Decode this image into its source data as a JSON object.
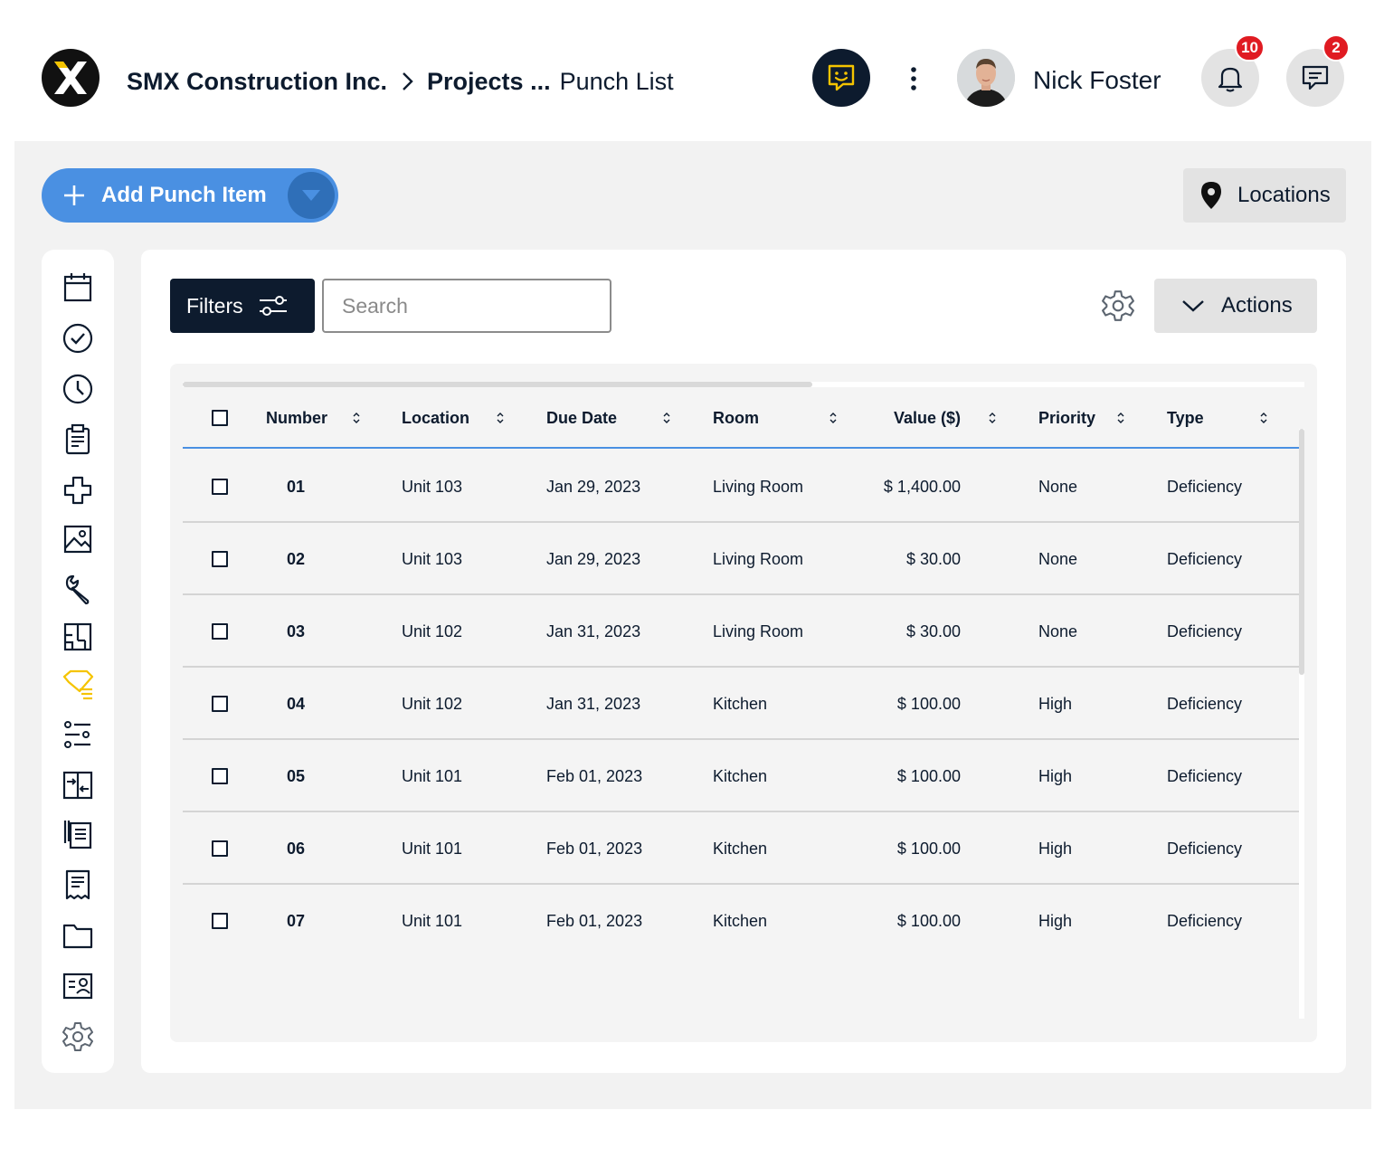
{
  "header": {
    "company": "SMX Construction Inc.",
    "breadcrumb_sep_icon": "chevron-right-icon",
    "projects": "Projects ...",
    "current_page": "Punch List",
    "user_name": "Nick Foster",
    "notifications_count": "10",
    "messages_count": "2",
    "accent_yellow": "#f5c400",
    "brand_navy": "#0d1b2e"
  },
  "toolbar": {
    "add_label": "Add Punch Item",
    "locations_label": "Locations",
    "primary_color": "#4a90e2"
  },
  "card": {
    "filters_label": "Filters",
    "search_placeholder": "Search",
    "actions_label": "Actions"
  },
  "sidebar": {
    "items": [
      {
        "icon": "calendar-icon"
      },
      {
        "icon": "check-circle-icon"
      },
      {
        "icon": "clock-icon"
      },
      {
        "icon": "clipboard-icon"
      },
      {
        "icon": "plus-cross-icon"
      },
      {
        "icon": "image-icon"
      },
      {
        "icon": "wrench-icon"
      },
      {
        "icon": "floorplan-icon"
      },
      {
        "icon": "punch-list-tag-icon",
        "active": true
      },
      {
        "icon": "sliders-list-icon"
      },
      {
        "icon": "transfer-icon"
      },
      {
        "icon": "document-stack-icon"
      },
      {
        "icon": "receipt-icon"
      },
      {
        "icon": "folder-icon"
      },
      {
        "icon": "contact-card-icon"
      },
      {
        "icon": "gear-icon"
      }
    ]
  },
  "table": {
    "columns": {
      "number": "Number",
      "location": "Location",
      "due_date": "Due Date",
      "room": "Room",
      "value": "Value ($)",
      "priority": "Priority",
      "type": "Type"
    },
    "rows": [
      {
        "number": "01",
        "location": "Unit 103",
        "due_date": "Jan 29, 2023",
        "room": "Living Room",
        "value": "$ 1,400.00",
        "priority": "None",
        "type": "Deficiency"
      },
      {
        "number": "02",
        "location": "Unit 103",
        "due_date": "Jan 29, 2023",
        "room": "Living Room",
        "value": "$ 30.00",
        "priority": "None",
        "type": "Deficiency"
      },
      {
        "number": "03",
        "location": "Unit 102",
        "due_date": "Jan 31, 2023",
        "room": "Living Room",
        "value": "$ 30.00",
        "priority": "None",
        "type": "Deficiency"
      },
      {
        "number": "04",
        "location": "Unit 102",
        "due_date": "Jan 31, 2023",
        "room": "Kitchen",
        "value": "$ 100.00",
        "priority": "High",
        "type": "Deficiency"
      },
      {
        "number": "05",
        "location": "Unit 101",
        "due_date": "Feb 01, 2023",
        "room": "Kitchen",
        "value": "$ 100.00",
        "priority": "High",
        "type": "Deficiency"
      },
      {
        "number": "06",
        "location": "Unit 101",
        "due_date": "Feb 01, 2023",
        "room": "Kitchen",
        "value": "$ 100.00",
        "priority": "High",
        "type": "Deficiency"
      },
      {
        "number": "07",
        "location": "Unit 101",
        "due_date": "Feb 01, 2023",
        "room": "Kitchen",
        "value": "$ 100.00",
        "priority": "High",
        "type": "Deficiency"
      }
    ]
  }
}
